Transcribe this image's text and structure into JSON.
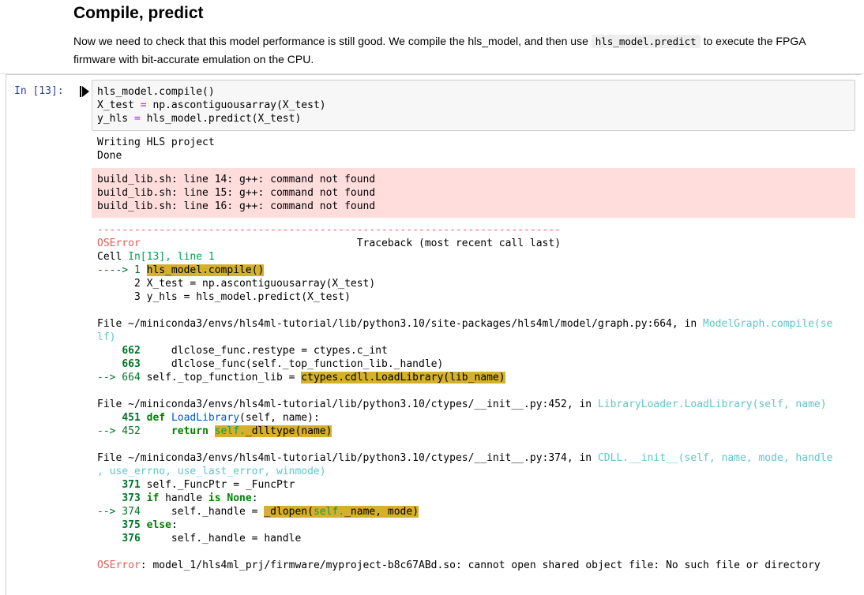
{
  "markdown": {
    "heading": "Compile, predict",
    "para_before": "Now we need to check that this model performance is still good. We compile the hls_model, and then use ",
    "para_code": "hls_model.predict",
    "para_after": " to execute the FPGA firmware with bit-accurate emulation on the CPU."
  },
  "cell": {
    "prompt": "In [13]:",
    "code": {
      "l1": "hls_model.compile()",
      "l2a": "X_test ",
      "l2op": "=",
      "l2b": " np.ascontiguousarray(X_test)",
      "l3a": "y_hls ",
      "l3op": "=",
      "l3b": " hls_model.predict(X_test)"
    },
    "stdout": [
      "Writing HLS project",
      "Done"
    ],
    "stderr": [
      "build_lib.sh: line 14: g++: command not found",
      "build_lib.sh: line 15: g++: command not found",
      "build_lib.sh: line 16: g++: command not found"
    ],
    "traceback": {
      "sep": "---------------------------------------------------------------------------",
      "error_type": "OSError",
      "tb_label": "Traceback (most recent call last)",
      "cell_ref_prefix": "Cell ",
      "cell_ref_link": "In[13], line 1",
      "f0_arrow": "----> 1 ",
      "f0_hl": "hls_model.compile()",
      "f0_l2": "      2 X_test = np.ascontiguousarray(X_test)",
      "f0_l3": "      3 y_hls = hls_model.predict(X_test)",
      "f1_file": "File ~/miniconda3/envs/hls4ml-tutorial/lib/python3.10/site-packages/hls4ml/model/graph.py:664, in ",
      "f1_func": "ModelGraph.compile(se",
      "f1_func2": "lf)",
      "f1_662": "662",
      "f1_662_code": "     dlclose_func.restype = ctypes.c_int",
      "f1_663": "663",
      "f1_663_code": "     dlclose_func(self._top_function_lib._handle)",
      "f1_arrow": "--> 664",
      "f1_664_code": " self._top_function_lib = ",
      "f1_664_hl": "ctypes.cdll.LoadLibrary(lib_name)",
      "f2_file": "File ~/miniconda3/envs/hls4ml-tutorial/lib/python3.10/ctypes/__init__.py:452, in ",
      "f2_func": "LibraryLoader.LoadLibrary(self, name)",
      "f2_451": "451",
      "f2_451_def": "def",
      "f2_451_name": "LoadLibrary",
      "f2_451_rest": "(self, name):",
      "f2_arrow": "--> 452",
      "f2_452_ret": "return",
      "f2_452_hl_a": "self.",
      "f2_452_hl_b": "_dlltype(name)",
      "f3_file": "File ~/miniconda3/envs/hls4ml-tutorial/lib/python3.10/ctypes/__init__.py:374, in ",
      "f3_func": "CDLL.__init__(self, name, mode, handle",
      "f3_func2": ", use_errno, use_last_error, winmode)",
      "f3_371": "371",
      "f3_371_code": " self._FuncPtr = _FuncPtr",
      "f3_373": "373",
      "f3_373_if": "if",
      "f3_373_mid": " handle ",
      "f3_373_is": "is",
      "f3_373_none": "None",
      "f3_373_colon": ":",
      "f3_arrow": "--> 374",
      "f3_374_code": "     self._handle = ",
      "f3_374_hl_a": "_dlopen(",
      "f3_374_hl_b": "self.",
      "f3_374_hl_c": "_name, mode)",
      "f3_375": "375",
      "f3_375_else": "else",
      "f3_375_colon": ":",
      "f3_376": "376",
      "f3_376_code": "     self._handle = handle",
      "final_type": "OSError",
      "final_msg": ": model_1/hls4ml_prj/firmware/myproject-b8c67ABd.so: cannot open shared object file: No such file or directory"
    }
  }
}
